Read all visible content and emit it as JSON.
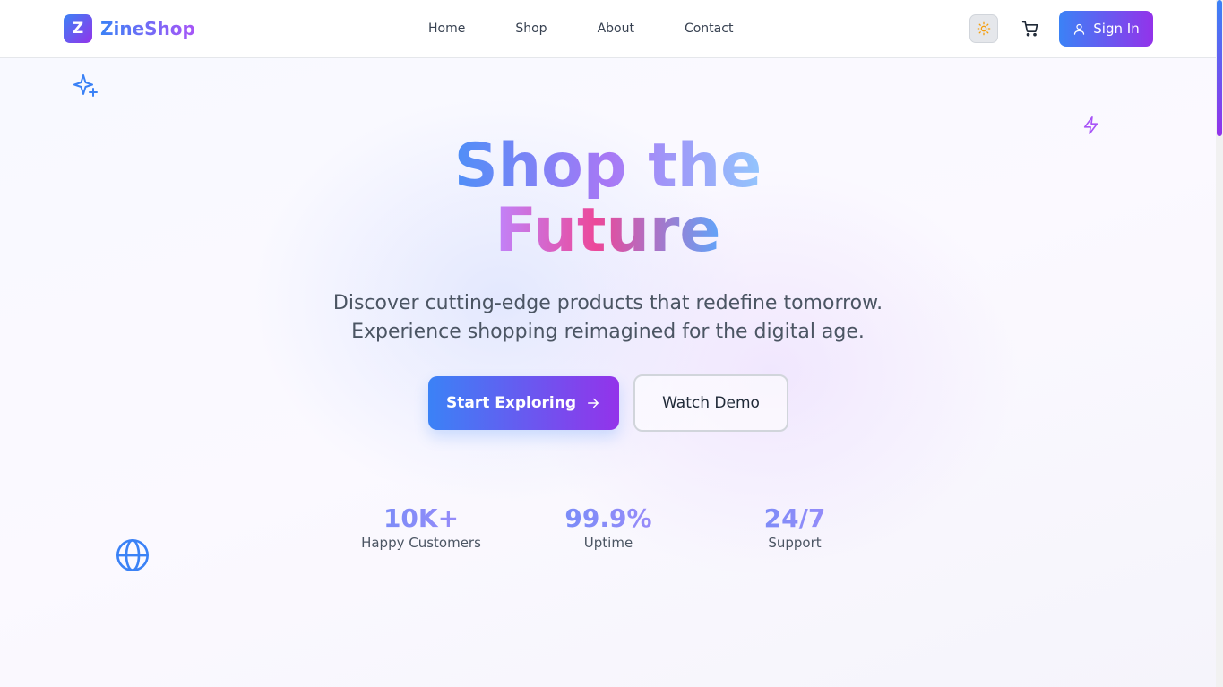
{
  "brand": {
    "initial": "Z",
    "name": "ZineShop"
  },
  "nav": {
    "items": [
      "Home",
      "Shop",
      "About",
      "Contact"
    ]
  },
  "actions": {
    "theme_icon": "sun-icon",
    "cart_icon": "cart-icon",
    "signin_label": "Sign In"
  },
  "hero": {
    "title_line1": "Shop the",
    "title_line2": "Future",
    "subtitle_line1": "Discover cutting-edge products that redefine tomorrow.",
    "subtitle_line2": "Experience shopping reimagined for the digital age.",
    "primary_button": "Start Exploring",
    "secondary_button": "Watch Demo"
  },
  "stats": [
    {
      "value": "10K+",
      "label": "Happy Customers"
    },
    {
      "value": "99.9%",
      "label": "Uptime"
    },
    {
      "value": "24/7",
      "label": "Support"
    }
  ],
  "decorations": [
    "sparkles-icon",
    "zap-icon",
    "globe-icon"
  ],
  "colors": {
    "accent_blue": "#3b82f6",
    "accent_purple": "#9333ea",
    "sun": "#f59e0b"
  }
}
